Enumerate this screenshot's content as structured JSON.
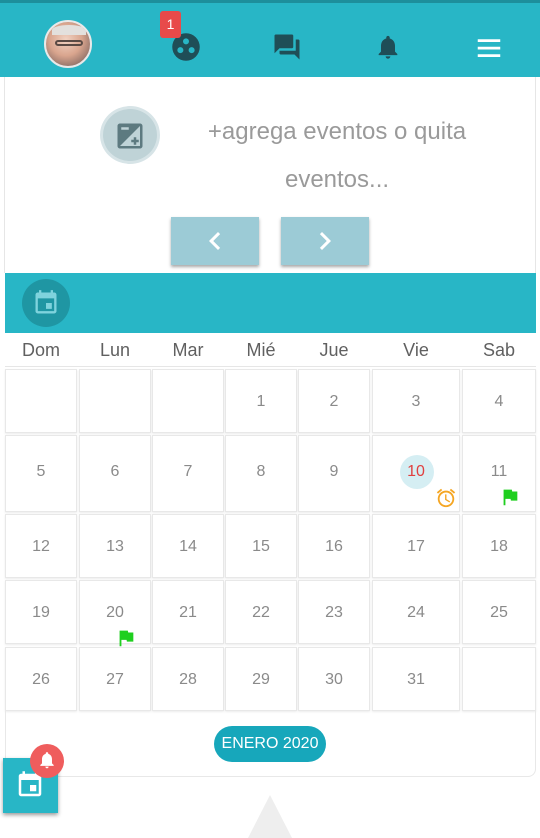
{
  "topbar": {
    "badge_count": "1",
    "icons": [
      "avatar",
      "groups-icon",
      "forum-icon",
      "notifications-icon",
      "menu-icon"
    ]
  },
  "events_card": {
    "add_text": "+agrega eventos o quita eventos...",
    "prev_icon": "chevron-left-icon",
    "next_icon": "chevron-right-icon"
  },
  "calendar": {
    "days_of_week": [
      "Dom",
      "Lun",
      "Mar",
      "Mié",
      "Jue",
      "Vie",
      "Sab"
    ],
    "weeks": [
      [
        "",
        "",
        "",
        "1",
        "2",
        "3",
        "4"
      ],
      [
        "5",
        "6",
        "7",
        "8",
        "9",
        "10",
        "11"
      ],
      [
        "12",
        "13",
        "14",
        "15",
        "16",
        "17",
        "18"
      ],
      [
        "19",
        "20",
        "21",
        "22",
        "23",
        "24",
        "25"
      ],
      [
        "26",
        "27",
        "28",
        "29",
        "30",
        "31",
        ""
      ]
    ],
    "today": "10",
    "events": [
      {
        "day": "10",
        "icon": "alarm-icon",
        "color": "#f5a623"
      },
      {
        "day": "11",
        "icon": "flag-icon",
        "color": "#1fcf1f"
      },
      {
        "day": "20",
        "icon": "flag-icon",
        "color": "#1fcf1f"
      }
    ],
    "month_label": "ENERO 2020"
  },
  "colors": {
    "primary": "#28b6c6",
    "today_text": "#e04040",
    "badge": "#e84a4a"
  }
}
